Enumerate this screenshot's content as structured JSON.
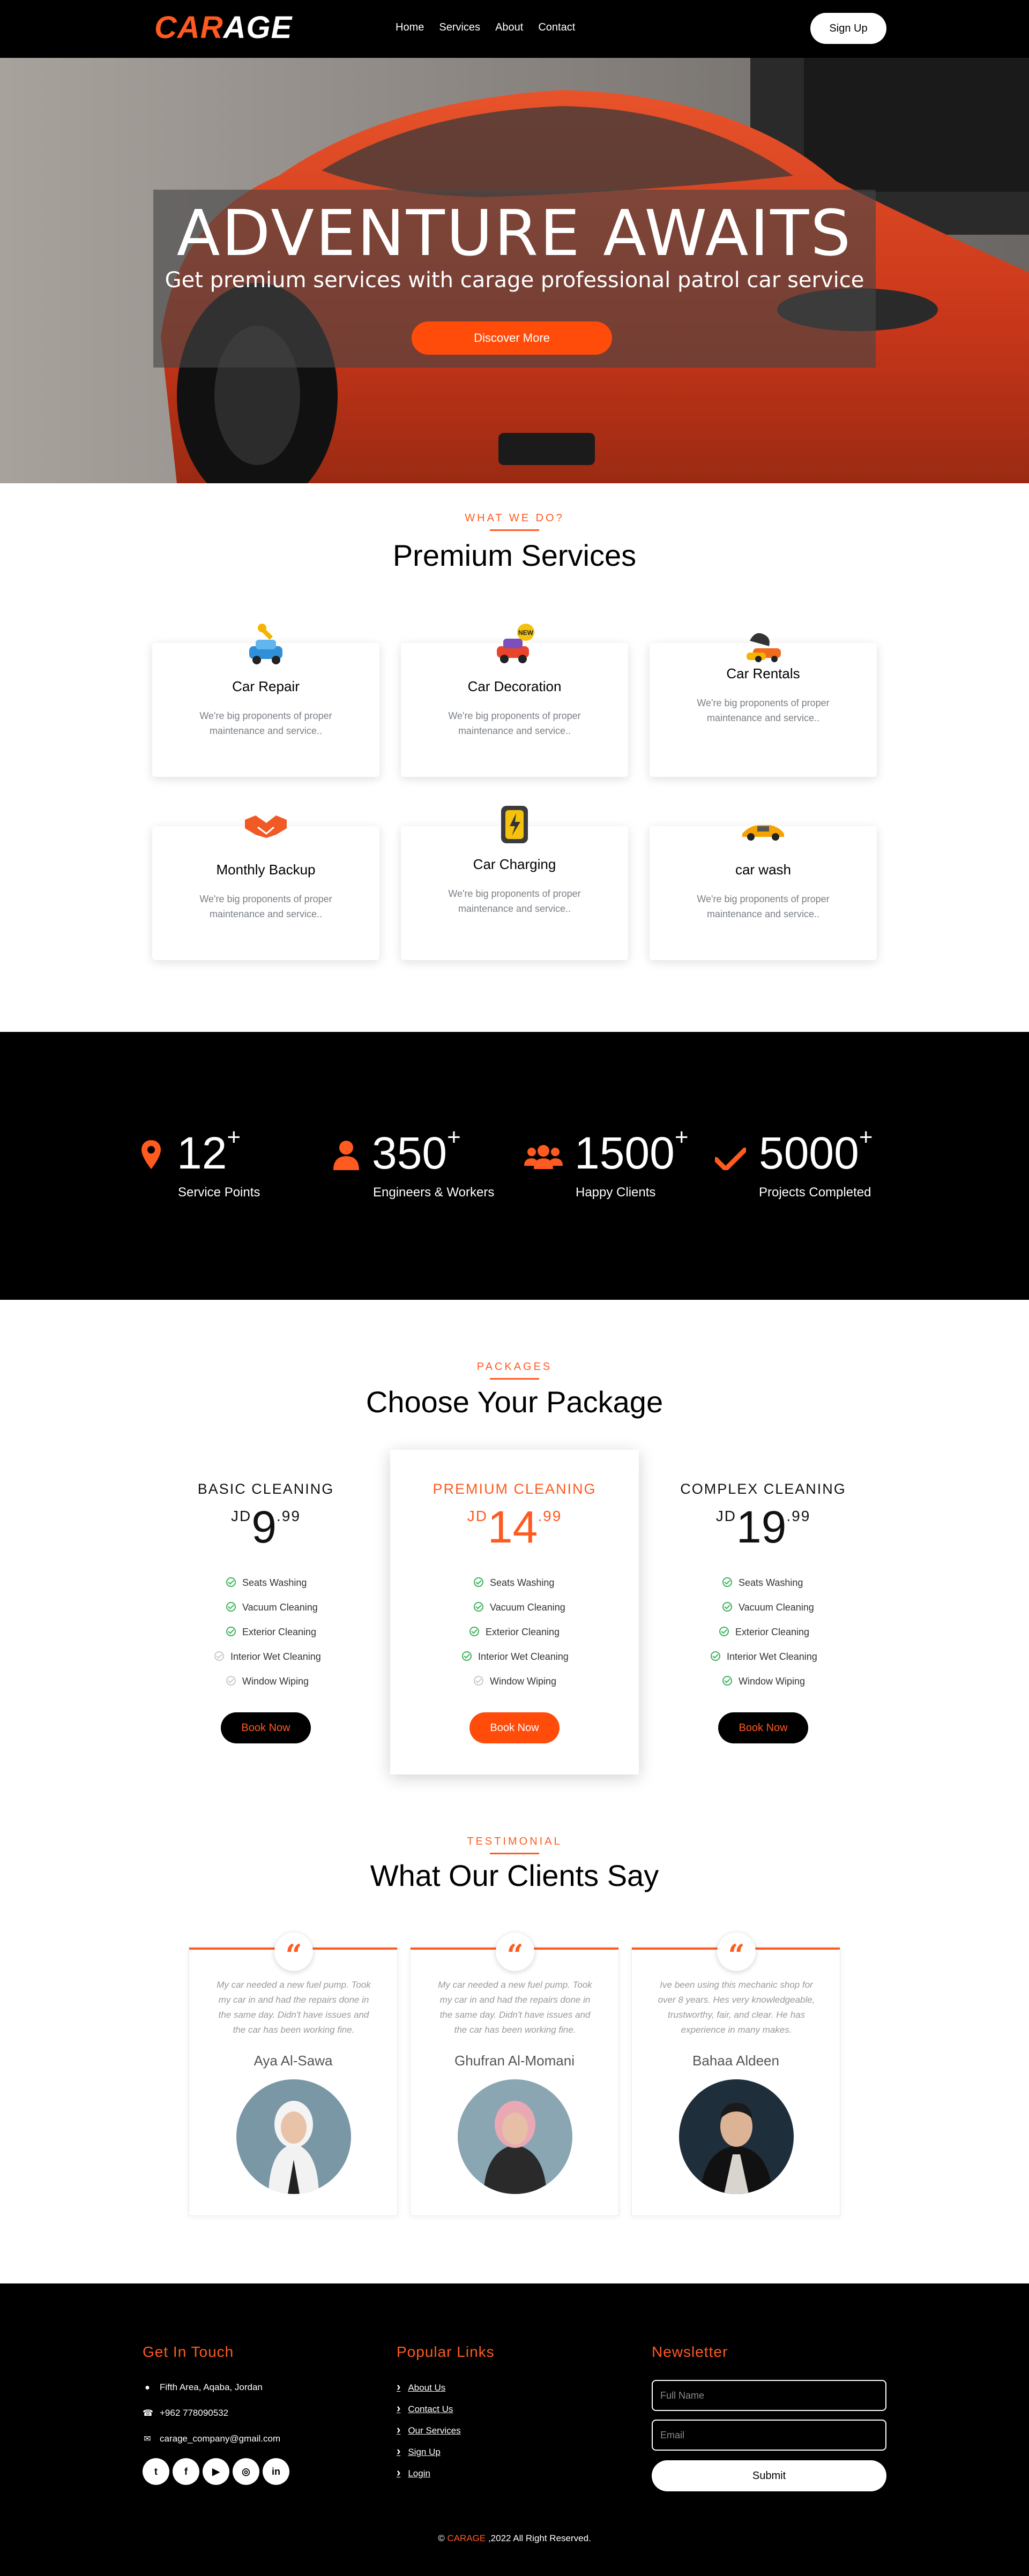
{
  "brand": {
    "logo_part1": "CAR",
    "logo_part2": "AGE"
  },
  "nav": {
    "links": [
      "Home",
      "Services",
      "About",
      "Contact"
    ],
    "signup_label": "Sign Up"
  },
  "hero": {
    "title": "ADVENTURE AWAITS",
    "subtitle": "Get premium services with carage professional patrol car service",
    "button_label": "Discover More"
  },
  "services": {
    "kicker": "WHAT WE DO?",
    "title": "Premium Services",
    "items": [
      {
        "title": "Car Repair",
        "icon": "car-repair-icon",
        "desc": "We're big proponents of proper maintenance and service.."
      },
      {
        "title": "Car Decoration",
        "icon": "car-decoration-icon",
        "desc": "We're big proponents of proper maintenance and service.."
      },
      {
        "title": "Car Rentals",
        "icon": "car-rental-icon",
        "desc": "We're big proponents of proper maintenance and service.."
      },
      {
        "title": "Monthly Backup",
        "icon": "handshake-icon",
        "desc": "We're big proponents of proper maintenance and service.."
      },
      {
        "title": "Car Charging",
        "icon": "car-charging-icon",
        "desc": "We're big proponents of proper maintenance and service.."
      },
      {
        "title": "car wash",
        "icon": "car-wash-icon",
        "desc": "We're big proponents of proper maintenance and service.."
      }
    ]
  },
  "stats": [
    {
      "number": "12",
      "plus": "+",
      "label": "Service Points",
      "icon": "map-marker-icon"
    },
    {
      "number": "350",
      "plus": "+",
      "label": "Engineers & Workers",
      "icon": "user-icon"
    },
    {
      "number": "1500",
      "plus": "+",
      "label": "Happy Clients",
      "icon": "users-icon"
    },
    {
      "number": "5000",
      "plus": "+",
      "label": "Projects Completed",
      "icon": "check-icon"
    }
  ],
  "packages": {
    "kicker": "PACKAGES",
    "title": "Choose Your Package",
    "items": [
      {
        "name": "BASIC CLEANING",
        "currency": "JD",
        "price": "9",
        "cents": ".99",
        "button": "Book Now",
        "features": [
          {
            "label": "Seats Washing",
            "included": true
          },
          {
            "label": "Vacuum Cleaning",
            "included": true
          },
          {
            "label": "Exterior Cleaning",
            "included": true
          },
          {
            "label": "Interior Wet Cleaning",
            "included": false
          },
          {
            "label": "Window Wiping",
            "included": false
          }
        ]
      },
      {
        "name": "PREMIUM CLEANING",
        "currency": "JD",
        "price": "14",
        "cents": ".99",
        "button": "Book Now",
        "features": [
          {
            "label": "Seats Washing",
            "included": true
          },
          {
            "label": "Vacuum Cleaning",
            "included": true
          },
          {
            "label": "Exterior Cleaning",
            "included": true
          },
          {
            "label": "Interior Wet Cleaning",
            "included": true
          },
          {
            "label": "Window Wiping",
            "included": false
          }
        ]
      },
      {
        "name": "COMPLEX CLEANING",
        "currency": "JD",
        "price": "19",
        "cents": ".99",
        "button": "Book Now",
        "features": [
          {
            "label": "Seats Washing",
            "included": true
          },
          {
            "label": "Vacuum Cleaning",
            "included": true
          },
          {
            "label": "Exterior Cleaning",
            "included": true
          },
          {
            "label": "Interior Wet Cleaning",
            "included": true
          },
          {
            "label": "Window Wiping",
            "included": true
          }
        ]
      }
    ]
  },
  "testimonials": {
    "kicker": "TESTIMONIAL",
    "title": "What Our Clients Say",
    "items": [
      {
        "text": "My car needed a new fuel pump. Took my car in and had the repairs done in the same day. Didn't have issues and the car has been working fine.",
        "name": "Aya Al-Sawa"
      },
      {
        "text": "My car needed a new fuel pump. Took my car in and had the repairs done in the same day. Didn't have issues and the car has been working fine.",
        "name": "Ghufran Al-Momani"
      },
      {
        "text": "Ive been using this mechanic shop for over 8 years. Hes very knowledgeable, trustworthy, fair, and clear. He has experience in many makes.",
        "name": "Bahaa Aldeen"
      }
    ]
  },
  "footer": {
    "contact_heading": "Get In Touch",
    "address": "Fifth Area, Aqaba, Jordan",
    "phone": "+962 778090532",
    "email": "carage_company@gmail.com",
    "socials": [
      "twitter-icon",
      "facebook-icon",
      "youtube-icon",
      "instagram-icon",
      "linkedin-icon"
    ],
    "links_heading": "Popular Links",
    "links": [
      "About Us",
      "Contact Us",
      "Our Services",
      "Sign Up",
      "Login"
    ],
    "newsletter_heading": "Newsletter",
    "name_placeholder": "Full Name",
    "email_placeholder": "Email",
    "submit_label": "Submit",
    "copyright_prefix": "© ",
    "copyright_brand": "CARAGE",
    "copyright_suffix": " ,2022 All Right Reserved."
  },
  "colors": {
    "accent": "#ff5a1f",
    "dark": "#000000",
    "light": "#ffffff",
    "check": "#3bb15a"
  }
}
